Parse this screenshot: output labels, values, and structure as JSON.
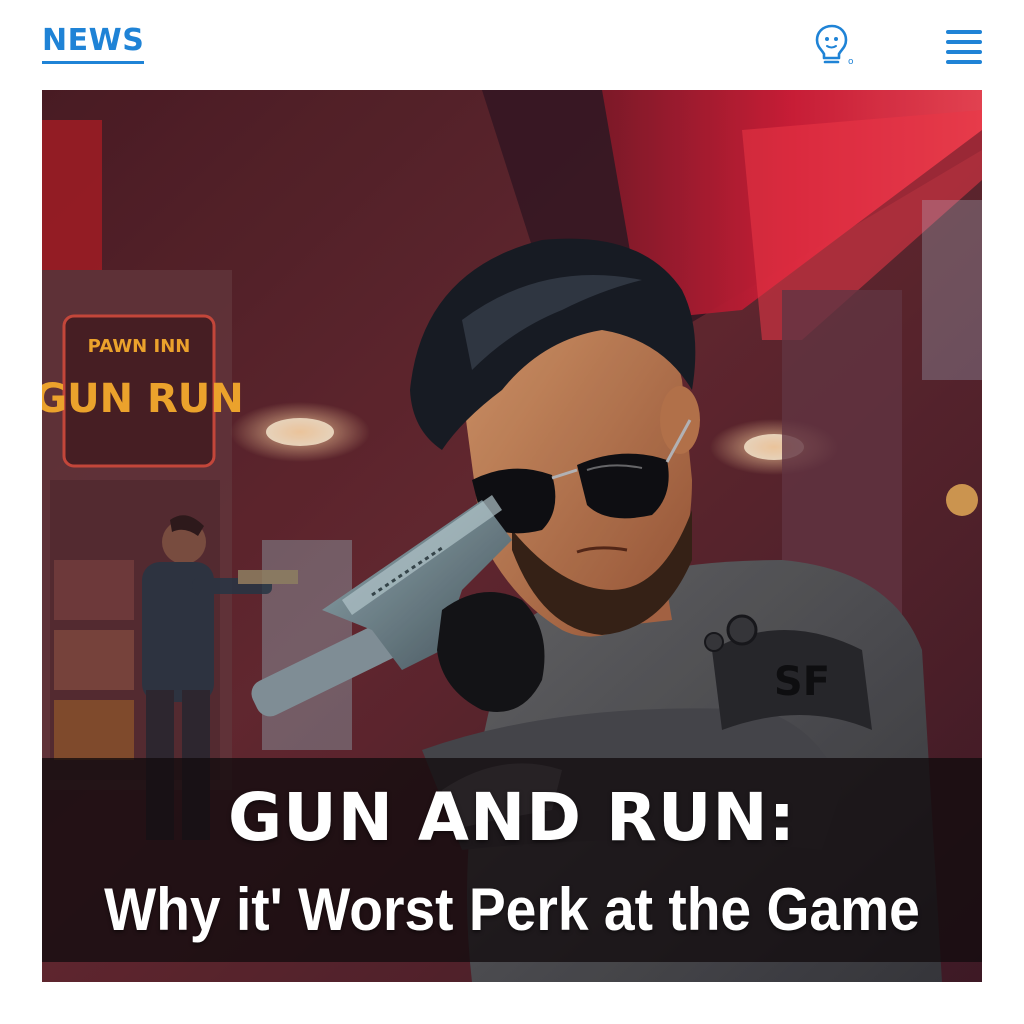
{
  "header": {
    "logo_text": "NEWS",
    "idea_icon": "lightbulb-icon",
    "menu_icon": "hamburger-menu-icon"
  },
  "hero": {
    "headline": "GUN AND RUN:",
    "subheadline": "Why it' Worst Perk at the Game",
    "sign_line_1": "PAWN INN",
    "sign_line_2": "GUN RUN",
    "sleeve_patch": "SF"
  },
  "colors": {
    "brand_blue": "#1f83d6",
    "neon_red": "#e0203c",
    "sign_orange": "#ffb030"
  }
}
